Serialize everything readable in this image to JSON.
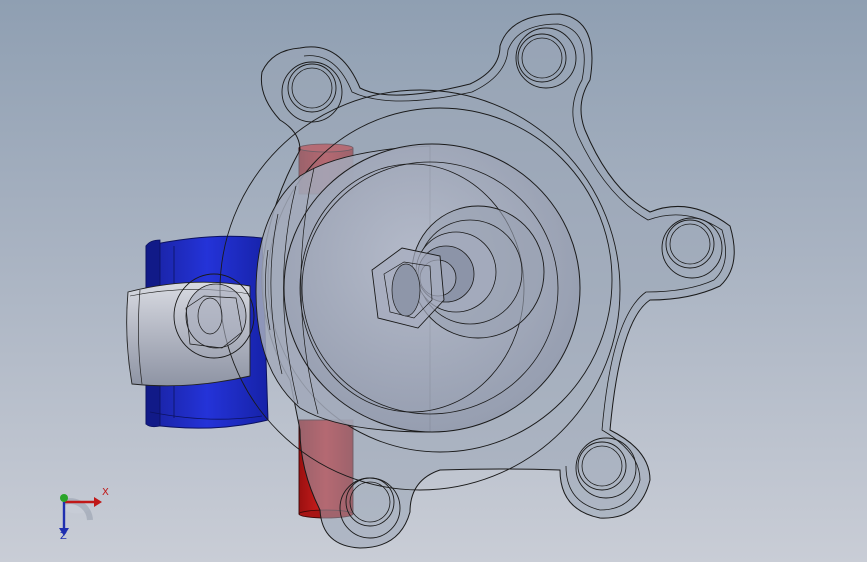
{
  "viewport": {
    "background_top": "#8f9fb2",
    "background_bottom": "#c9cdd6"
  },
  "model": {
    "icon": "valve-assembly-model",
    "colors": {
      "edge": "#1c1c1c",
      "flange_fill": "#9ba5b5",
      "body_fill": "#a7adbd",
      "pin": "#c41a1a",
      "pin_dark": "#8e1010",
      "clamp": "#1c28c8",
      "clamp_dark": "#101a8c",
      "band": "#b9bcc6"
    }
  },
  "triad": {
    "x_label": "X",
    "z_label": "Z",
    "x_color": "#c01818",
    "y_color": "#2aa52a",
    "z_color": "#1f2fb0"
  }
}
